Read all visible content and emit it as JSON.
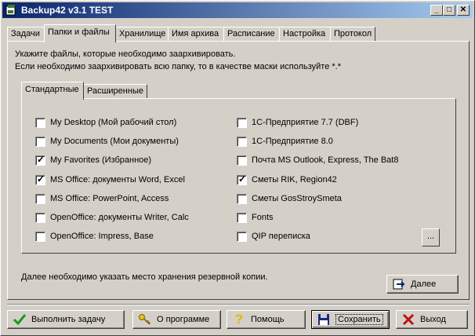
{
  "window": {
    "title": "Backup42 v3.1    TEST"
  },
  "tabs": [
    "Задачи",
    "Папки и файлы",
    "Хранилище",
    "Имя архива",
    "Расписание",
    "Настройка",
    "Протокол"
  ],
  "intro": {
    "line1": "Укажите файлы, которые необходимо заархивировать.",
    "line2": "Если необходимо заархивировать всю папку, то в качестве маски используйте *.*"
  },
  "subtabs": [
    "Стандартные",
    "Расширенные"
  ],
  "left_items": [
    {
      "label": "My Desktop (Мой рабочий стол)",
      "checked": false
    },
    {
      "label": "My Documents (Мои документы)",
      "checked": false
    },
    {
      "label": "My Favorites (Избранное)",
      "checked": true
    },
    {
      "label": "MS Office: документы Word, Excel",
      "checked": true
    },
    {
      "label": "MS Office: PowerPoint, Access",
      "checked": false
    },
    {
      "label": "OpenOffice: документы Writer, Calc",
      "checked": false
    },
    {
      "label": "OpenOffice: Impress, Base",
      "checked": false
    }
  ],
  "right_items": [
    {
      "label": "1С-Предприятие 7.7 (DBF)",
      "checked": false
    },
    {
      "label": "1С-Предприятие 8.0",
      "checked": false
    },
    {
      "label": "Почта MS Outlook, Express, The Bat8",
      "checked": false
    },
    {
      "label": "Сметы RIK, Region42",
      "checked": true
    },
    {
      "label": "Сметы GosStroySmeta",
      "checked": false
    },
    {
      "label": "Fonts",
      "checked": false
    },
    {
      "label": "QIP переписка",
      "checked": false
    }
  ],
  "more_button": "...",
  "note": "Далее необходимо указать место хранения резервной копии.",
  "next_button": "Далее",
  "bottom": {
    "run": "Выполнить задачу",
    "about": "О программе",
    "help": "Помощь",
    "save": "Сохранить",
    "exit": "Выход"
  }
}
